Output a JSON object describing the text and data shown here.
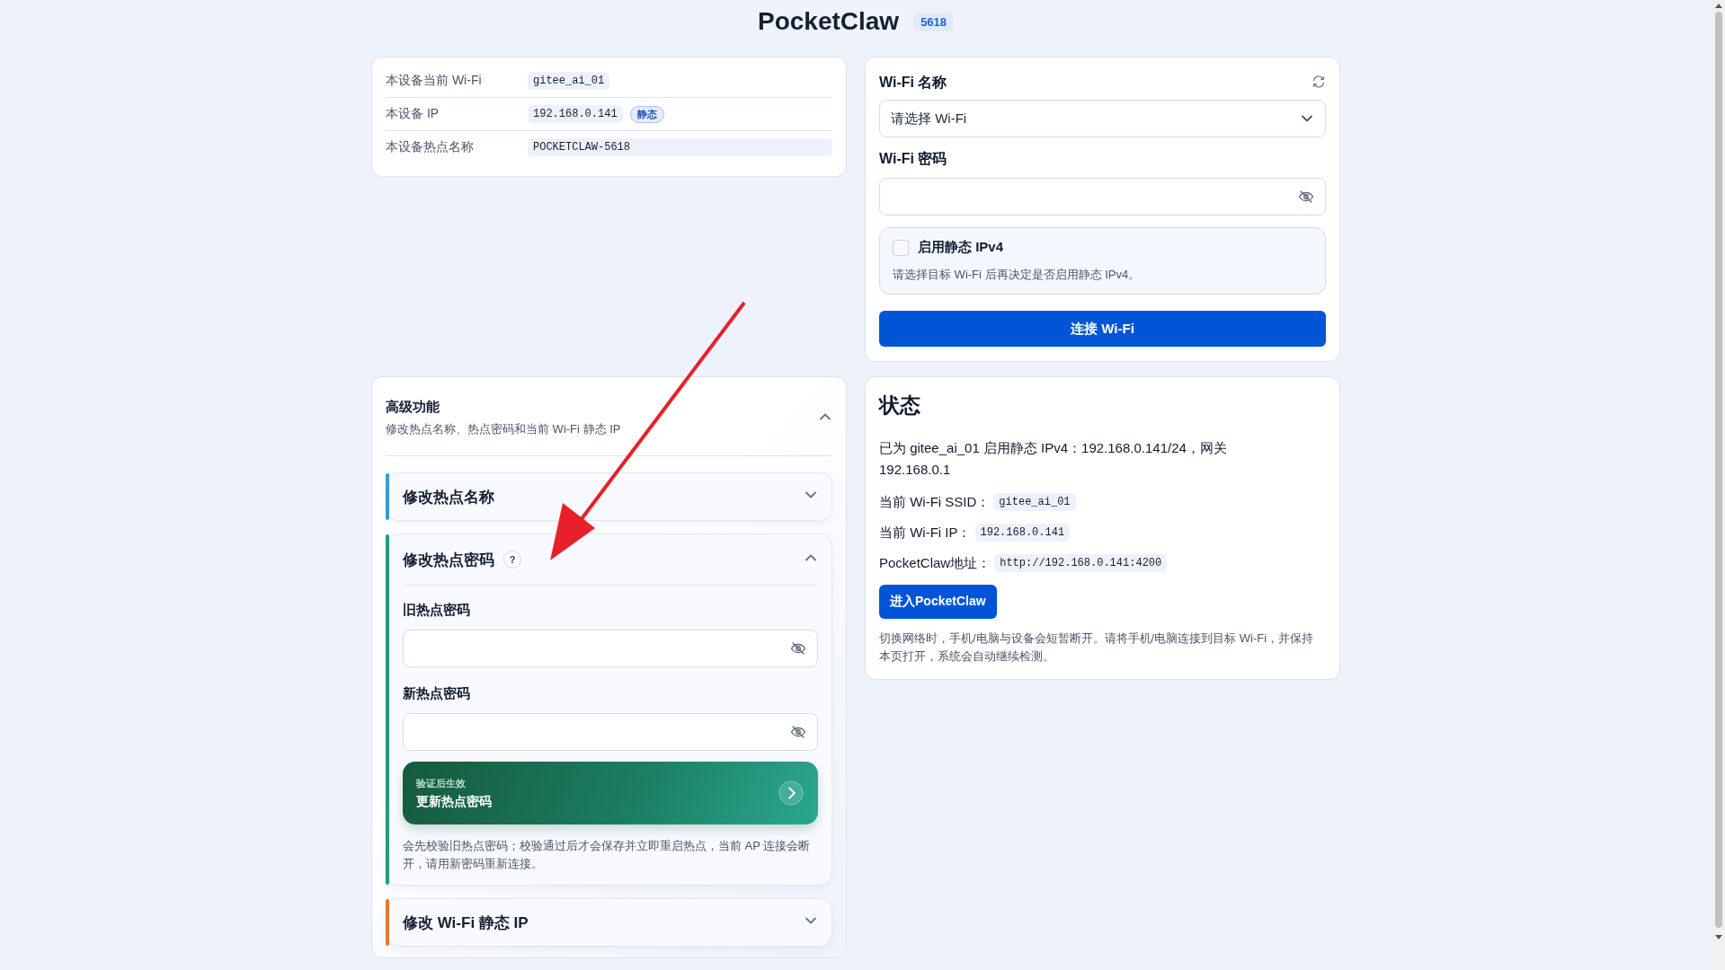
{
  "header": {
    "title": "PocketClaw",
    "badge": "5618"
  },
  "device_info": [
    {
      "label": "本设备当前 Wi-Fi",
      "value": "gitee_ai_01",
      "kind": "chip"
    },
    {
      "label": "本设备 IP",
      "value": "192.168.0.141",
      "tag": "静态",
      "kind": "chip"
    },
    {
      "label": "本设备热点名称",
      "value": "POCKETCLAW-5618",
      "kind": "wide"
    }
  ],
  "wifi_form": {
    "name_label": "Wi-Fi 名称",
    "select_placeholder": "请选择 Wi-Fi",
    "password_label": "Wi-Fi 密码",
    "static_ipv4": {
      "label": "启用静态 IPv4",
      "checked": false,
      "hint": "请选择目标 Wi-Fi 后再决定是否启用静态 IPv4。"
    },
    "connect_button": "连接 Wi-Fi"
  },
  "advanced": {
    "title": "高级功能",
    "subtitle": "修改热点名称、热点密码和当前 Wi-Fi 静态 IP",
    "expanded": true,
    "sections": [
      {
        "title": "修改热点名称",
        "color": "#2f9fd0",
        "expanded": false
      },
      {
        "title": "修改热点密码",
        "help": "?",
        "color": "#1f9e78",
        "expanded": true,
        "fields": [
          {
            "label": "旧热点密码"
          },
          {
            "label": "新热点密码"
          }
        ],
        "action": {
          "caption": "验证后生效",
          "label": "更新热点密码"
        },
        "note": "会先校验旧热点密码；校验通过后才会保存并立即重启热点，当前 AP 连接会断开，请用新密码重新连接。"
      },
      {
        "title": "修改 Wi-Fi 静态 IP",
        "color": "#e8772e",
        "expanded": false
      }
    ]
  },
  "status": {
    "title": "状态",
    "message": "已为 gitee_ai_01 启用静态 IPv4：192.168.0.141/24，网关 192.168.0.1",
    "lines": [
      {
        "label": "当前 Wi-Fi SSID：",
        "value": "gitee_ai_01"
      },
      {
        "label": "当前 Wi-Fi IP：",
        "value": "192.168.0.141"
      },
      {
        "label": "PocketClaw地址：",
        "value": "http://192.168.0.141:4200"
      }
    ],
    "button": "进入PocketClaw",
    "note": "切换网络时，手机/电脑与设备会短暂断开。请将手机/电脑连接到目标 Wi-Fi，并保持本页打开，系统会自动继续检测。"
  }
}
